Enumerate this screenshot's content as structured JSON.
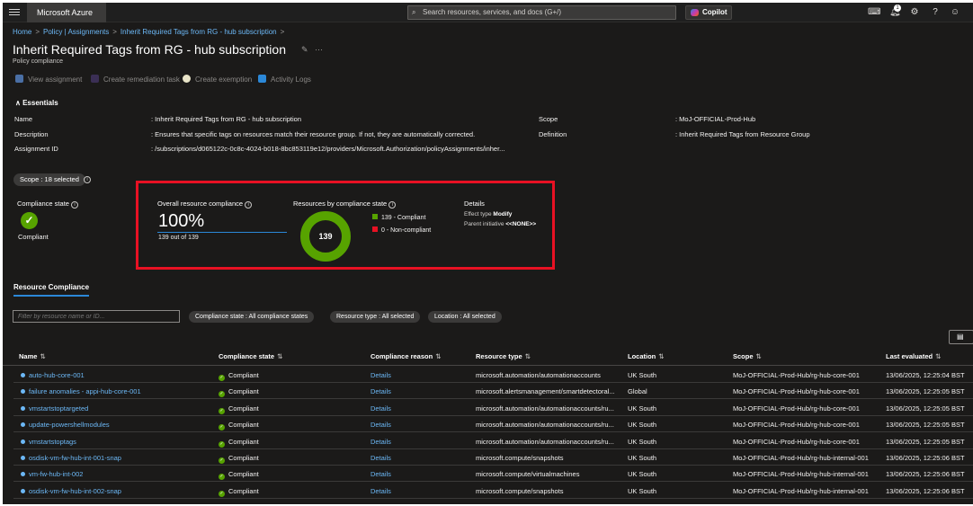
{
  "topbar": {
    "brand": "Microsoft Azure",
    "search_placeholder": "Search resources, services, and docs (G+/)",
    "copilot_label": "Copilot",
    "notification_count": "1"
  },
  "breadcrumb": [
    "Home",
    "Policy | Assignments",
    "Inherit Required Tags from RG - hub subscription"
  ],
  "page": {
    "title": "Inherit Required Tags from RG - hub subscription",
    "subtitle": "Policy compliance"
  },
  "commands": [
    "View assignment",
    "Create remediation task",
    "Create exemption",
    "Activity Logs"
  ],
  "essentials": {
    "heading": "Essentials",
    "rows": [
      {
        "label": "Name",
        "value": ": Inherit Required Tags from RG - hub subscription"
      },
      {
        "label": "Description",
        "value": ": Ensures that specific tags on resources match their resource group. If not, they are automatically corrected."
      },
      {
        "label": "Assignment ID",
        "value": ": /subscriptions/d065122c-0c8c-4024-b018-8bc853119e12/providers/Microsoft.Authorization/policyAssignments/inher..."
      }
    ],
    "right_rows": [
      {
        "label": "Scope",
        "value": ": MoJ-OFFICIAL-Prod-Hub"
      },
      {
        "label": "Definition",
        "value": ": Inherit Required Tags from Resource Group"
      }
    ]
  },
  "scope_button": "Scope : 18 selected",
  "compliance_state": {
    "label": "Compliance state",
    "value": "Compliant"
  },
  "overall": {
    "label": "Overall resource compliance",
    "percent": "100%",
    "sub": "139 out of 139"
  },
  "by_state": {
    "label": "Resources by compliance state",
    "total": "139",
    "compliant": 139,
    "noncompliant": 0,
    "legend": [
      "139 - Compliant",
      "0 - Non-compliant"
    ],
    "colors": {
      "compliant": "#57a300",
      "noncompliant": "#e81123"
    }
  },
  "details": {
    "label": "Details",
    "effect_label": "Effect type",
    "effect_value": "Modify",
    "initiative_label": "Parent initiative",
    "initiative_value": "<<NONE>>"
  },
  "tab": "Resource Compliance",
  "filters": {
    "search_placeholder": "Filter by resource name or ID...",
    "pills": [
      "Compliance state : All compliance states",
      "Resource type : All selected",
      "Location : All selected"
    ]
  },
  "table": {
    "columns": [
      "Name",
      "Compliance state",
      "Compliance reason",
      "Resource type",
      "Location",
      "Scope",
      "Last evaluated"
    ],
    "rows": [
      [
        "auto-hub-core-001",
        "Compliant",
        "Details",
        "microsoft.automation/automationaccounts",
        "UK South",
        "MoJ-OFFICIAL-Prod-Hub/rg-hub-core-001",
        "13/06/2025, 12:25:04 BST"
      ],
      [
        "failure anomalies - appi-hub-core-001",
        "Compliant",
        "Details",
        "microsoft.alertsmanagement/smartdetectoral...",
        "Global",
        "MoJ-OFFICIAL-Prod-Hub/rg-hub-core-001",
        "13/06/2025, 12:25:05 BST"
      ],
      [
        "vmstartstoptargeted",
        "Compliant",
        "Details",
        "microsoft.automation/automationaccounts/ru...",
        "UK South",
        "MoJ-OFFICIAL-Prod-Hub/rg-hub-core-001",
        "13/06/2025, 12:25:05 BST"
      ],
      [
        "update-powershellmodules",
        "Compliant",
        "Details",
        "microsoft.automation/automationaccounts/ru...",
        "UK South",
        "MoJ-OFFICIAL-Prod-Hub/rg-hub-core-001",
        "13/06/2025, 12:25:05 BST"
      ],
      [
        "vmstartstoptags",
        "Compliant",
        "Details",
        "microsoft.automation/automationaccounts/ru...",
        "UK South",
        "MoJ-OFFICIAL-Prod-Hub/rg-hub-core-001",
        "13/06/2025, 12:25:05 BST"
      ],
      [
        "osdisk-vm-fw-hub-int-001-snap",
        "Compliant",
        "Details",
        "microsoft.compute/snapshots",
        "UK South",
        "MoJ-OFFICIAL-Prod-Hub/rg-hub-internal-001",
        "13/06/2025, 12:25:06 BST"
      ],
      [
        "vm-fw-hub-int-002",
        "Compliant",
        "Details",
        "microsoft.compute/virtualmachines",
        "UK South",
        "MoJ-OFFICIAL-Prod-Hub/rg-hub-internal-001",
        "13/06/2025, 12:25:06 BST"
      ],
      [
        "osdisk-vm-fw-hub-int-002-snap",
        "Compliant",
        "Details",
        "microsoft.compute/snapshots",
        "UK South",
        "MoJ-OFFICIAL-Prod-Hub/rg-hub-internal-001",
        "13/06/2025, 12:25:06 BST"
      ]
    ]
  }
}
